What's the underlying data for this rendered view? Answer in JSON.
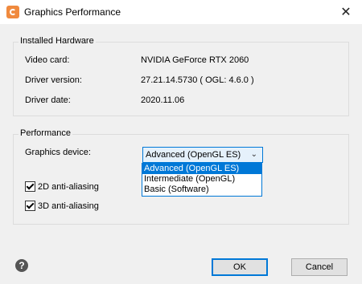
{
  "window": {
    "title": "Graphics Performance",
    "app_icon": "app-icon",
    "close_glyph": "✕"
  },
  "hardware": {
    "legend": "Installed Hardware",
    "rows": [
      {
        "label": "Video card:",
        "value": "NVIDIA GeForce RTX 2060"
      },
      {
        "label": "Driver version:",
        "value": "27.21.14.5730 ( OGL: 4.6.0 )"
      },
      {
        "label": "Driver date:",
        "value": "2020.11.06"
      }
    ]
  },
  "performance": {
    "legend": "Performance",
    "device_label": "Graphics device:",
    "device_selected": "Advanced (OpenGL ES)",
    "device_options": [
      "Advanced (OpenGL ES)",
      "Intermediate (OpenGL)",
      "Basic (Software)"
    ],
    "aa2d_label": "2D anti-aliasing",
    "aa2d_checked": true,
    "aa3d_label": "3D anti-aliasing",
    "aa3d_checked": true
  },
  "footer": {
    "help_glyph": "?",
    "ok_label": "OK",
    "cancel_label": "Cancel"
  },
  "colors": {
    "accent": "#0078d7",
    "app_icon": "#f08a3e"
  }
}
